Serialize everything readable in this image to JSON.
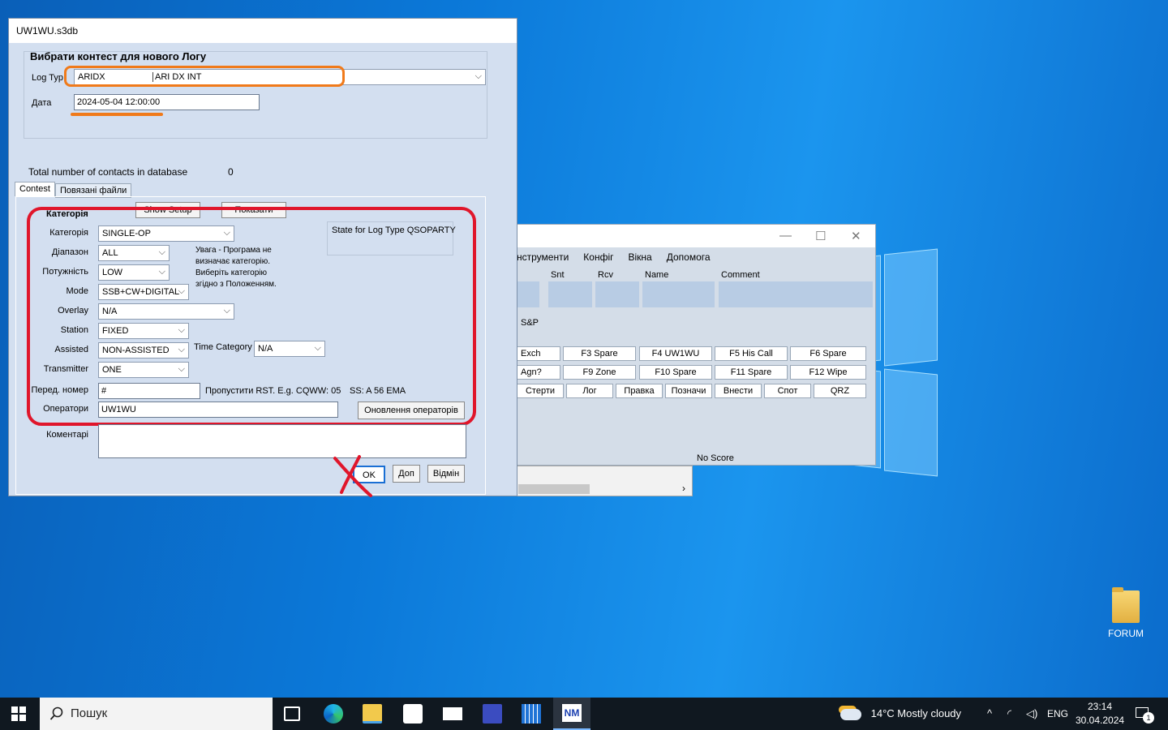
{
  "dialog": {
    "title": "UW1WU.s3db",
    "heading": "Вибрати контест для нового Логу",
    "log_type_label": "Log Typ",
    "log_type_code": "ARIDX",
    "log_type_name": "ARI DX INT",
    "date_label": "Дата",
    "date_value": "2024-05-04 12:00:00",
    "total_contacts_label": "Total number of contacts in database",
    "total_contacts_value": "0",
    "tabs": [
      "Contest",
      "Повязані файли"
    ],
    "show_setup": "Show Setup",
    "show_btn": "Показати",
    "category_group": "Категорія",
    "state_text": "State for Log Type QSOPARTY",
    "fields": {
      "category": {
        "label": "Категорія",
        "value": "SINGLE-OP"
      },
      "band": {
        "label": "Діапазон",
        "value": "ALL"
      },
      "power": {
        "label": "Потужність",
        "value": "LOW"
      },
      "mode": {
        "label": "Mode",
        "value": "SSB+CW+DIGITAL"
      },
      "overlay": {
        "label": "Overlay",
        "value": "N/A"
      },
      "station": {
        "label": "Station",
        "value": "FIXED"
      },
      "assisted": {
        "label": "Assisted",
        "value": "NON-ASSISTED"
      },
      "time_category": {
        "label": "Time Category",
        "value": "N/A"
      },
      "transmitter": {
        "label": "Transmitter",
        "value": "ONE"
      }
    },
    "warning_lines": [
      "Увага -  Програма не",
      "визначає категорію.",
      "Виберіть категорію",
      "згідно з Положенням."
    ],
    "sent_number_label": "Перед. номер",
    "sent_number_value": "#",
    "sent_hint": "Пропустити RST. E.g. CQWW: 05",
    "ss_hint": "SS: A 56 EMA",
    "operators_label": "Оператори",
    "operators_value": "UW1WU",
    "update_operators": "Оновлення операторів",
    "comments_label": "Коментарі",
    "ok": "OK",
    "help": "Доп",
    "cancel": "Відмін"
  },
  "bg_window": {
    "menu": [
      "нструменти",
      "Конфіг",
      "Вікна",
      "Допомога"
    ],
    "columns": [
      "Snt",
      "Rcv",
      "Name",
      "Comment"
    ],
    "sp": "S&P",
    "row1": [
      "Exch",
      "F3 Spare",
      "F4 UW1WU",
      "F5 His Call",
      "F6 Spare"
    ],
    "row2": [
      "Agn?",
      "F9 Zone",
      "F10 Spare",
      "F11 Spare",
      "F12 Wipe"
    ],
    "row3": [
      "Стерти",
      "Лог",
      "Правка",
      "Позначи",
      "Внести",
      "Спот",
      "QRZ"
    ],
    "score": "No Score"
  },
  "desktop": {
    "icon_label": "FORUM"
  },
  "taskbar": {
    "search_placeholder": "Пошук",
    "weather": "14°C  Mostly cloudy",
    "lang": "ENG",
    "time": "23:14",
    "date": "30.04.2024",
    "notif_count": "1"
  },
  "colors": {
    "annotation_red": "#e0162b",
    "annotation_orange": "#f07a1a",
    "dialog_bg": "#d3dff0"
  }
}
